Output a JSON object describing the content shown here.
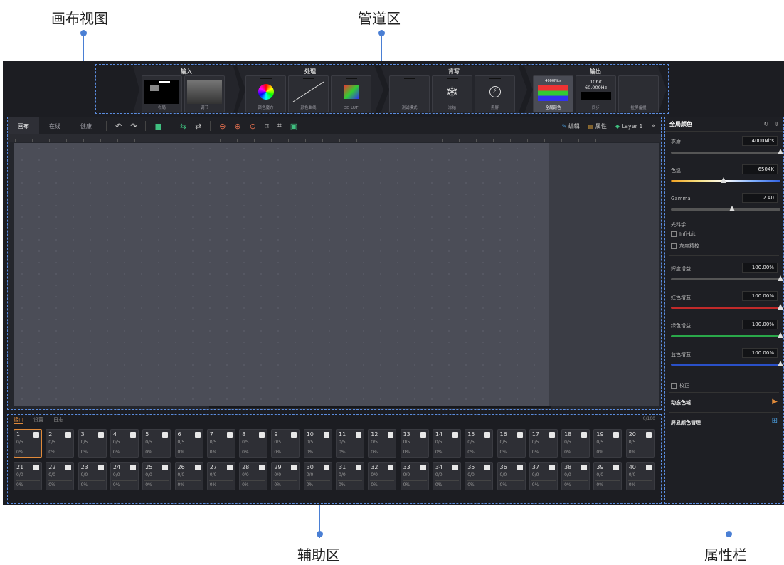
{
  "callouts": {
    "canvas_view": "画布视图",
    "pipeline_area": "管道区",
    "aux_area": "辅助区",
    "props_bar": "属性栏"
  },
  "pipeline": {
    "stages": [
      {
        "title": "输入",
        "nodes": [
          "布局",
          "调节"
        ]
      },
      {
        "title": "处理",
        "nodes": [
          "颜色魔方",
          "颜色曲线",
          "3D LUT"
        ]
      },
      {
        "title": "背写",
        "nodes": [
          "测试模式",
          "冻结",
          "黑屏"
        ]
      },
      {
        "title": "输出",
        "nodes": [
          "全局颜色",
          "同步",
          "拉屏备援"
        ]
      }
    ],
    "output_badge": "4000Nits",
    "sync_info": [
      "10bit",
      "60.000Hz"
    ]
  },
  "toolbar": {
    "tabs": [
      "画布",
      "在线",
      "健康"
    ],
    "edit_label": "编辑",
    "props_label": "属性",
    "layer_label": "Layer 1",
    "more": "»"
  },
  "aux": {
    "tabs": [
      "接口",
      "设置",
      "日志"
    ],
    "page": "0/100",
    "row1": [
      "1",
      "2",
      "3",
      "4",
      "5",
      "6",
      "7",
      "8",
      "9",
      "10",
      "11",
      "12",
      "13",
      "14",
      "15",
      "16",
      "17",
      "18",
      "19",
      "20"
    ],
    "row2": [
      "21",
      "22",
      "23",
      "24",
      "25",
      "26",
      "27",
      "28",
      "29",
      "30",
      "31",
      "32",
      "33",
      "34",
      "35",
      "36",
      "37",
      "38",
      "39",
      "40"
    ],
    "frac_row1": "0/5",
    "frac_row2": "0/0",
    "pct": "0%"
  },
  "props": {
    "title": "全局颜色",
    "brightness_label": "亮度",
    "brightness": "4000Nits",
    "temp_label": "色温",
    "temp": "6504K",
    "gamma_label": "Gamma",
    "gamma": "2.40",
    "optics_label": "光科学",
    "infi_bit": "Infi-bit",
    "gray_fine": "灰度精校",
    "bright_gain_label": "辉度增益",
    "bright_gain": "100.00%",
    "red_gain_label": "红色增益",
    "red_gain": "100.00%",
    "green_gain_label": "绿色增益",
    "green_gain": "100.00%",
    "blue_gain_label": "蓝色增益",
    "blue_gain": "100.00%",
    "calibrate": "校正",
    "dynamic_gamut": "动态色域",
    "screen_color_mgmt": "屏显颜色管理"
  },
  "slider_levels": {
    "brightness": 1.0,
    "temp": 0.48,
    "gamma": 0.56,
    "bright_gain": 1.0,
    "red_gain": 1.0,
    "green_gain": 1.0,
    "blue_gain": 1.0
  }
}
